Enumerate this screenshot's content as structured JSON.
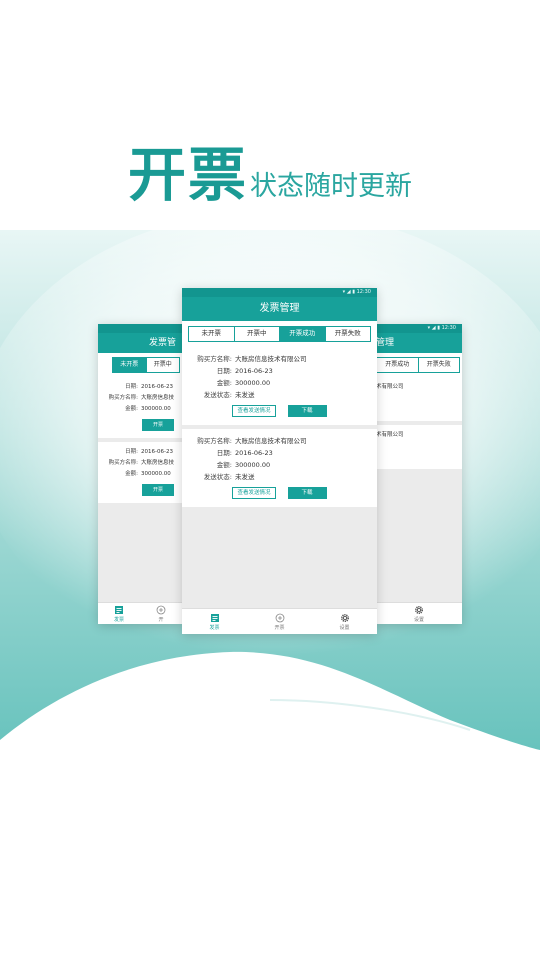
{
  "headline": {
    "big": "开票",
    "small": "状态随时更新",
    "color": "#1a9a94"
  },
  "colors": {
    "accent": "#17a19a",
    "status_bar": "#12958f",
    "content_bg": "#ebebeb"
  },
  "status_bar": {
    "time": "12:30",
    "icons": [
      "wifi-icon",
      "signal-icon",
      "battery-icon"
    ]
  },
  "center_screen": {
    "title": "发票管理",
    "tabs": [
      {
        "label": "未开票",
        "active": false
      },
      {
        "label": "开票中",
        "active": false
      },
      {
        "label": "开票成功",
        "active": true
      },
      {
        "label": "开票失败",
        "active": false
      }
    ],
    "cards": [
      {
        "buyer_label": "购买方名称:",
        "buyer": "大账房信息技术有限公司",
        "date_label": "日期:",
        "date": "2016-06-23",
        "amount_label": "金额:",
        "amount": "300000.00",
        "send_label": "发送状态:",
        "send_status": "未发送",
        "view_button": "查看发送情况",
        "download_button": "下载"
      },
      {
        "buyer_label": "购买方名称:",
        "buyer": "大账房信息技术有限公司",
        "date_label": "日期:",
        "date": "2016-06-23",
        "amount_label": "金额:",
        "amount": "300000.00",
        "send_label": "发送状态:",
        "send_status": "未发送",
        "view_button": "查看发送情况",
        "download_button": "下载"
      }
    ],
    "nav": [
      {
        "label": "发票",
        "icon": "invoice-icon",
        "active": true
      },
      {
        "label": "开票",
        "icon": "add-circle-icon",
        "active": false
      },
      {
        "label": "设置",
        "icon": "gear-icon",
        "active": false
      }
    ]
  },
  "left_screen": {
    "title": "发票管",
    "tabs": [
      {
        "label": "未开票",
        "active": true
      },
      {
        "label": "开票中",
        "active": false
      }
    ],
    "cards": [
      {
        "date_label": "日期:",
        "date": "2016-06-23",
        "buyer_label": "购买方名称:",
        "buyer": "大账房信息技",
        "amount_label": "金额:",
        "amount": "300000.00",
        "button": "开票"
      },
      {
        "date_label": "日期:",
        "date": "2016-06-23",
        "buyer_label": "购买方名称:",
        "buyer": "大账房信息技",
        "amount_label": "金额:",
        "amount": "300000.00",
        "button": "开票"
      }
    ],
    "nav": [
      {
        "label": "发票",
        "icon": "invoice-icon",
        "active": true
      },
      {
        "label": "开",
        "icon": "add-circle-icon",
        "active": false
      }
    ]
  },
  "right_screen": {
    "title": "管理",
    "tabs": [
      {
        "label": "开票成功",
        "active": false
      },
      {
        "label": "开票失败",
        "active": false
      }
    ],
    "cards": [
      {
        "buyer": "术有限公司"
      },
      {
        "buyer": "术有限公司"
      }
    ],
    "nav": [
      {
        "label": "设置",
        "icon": "gear-icon",
        "active": false
      }
    ]
  }
}
